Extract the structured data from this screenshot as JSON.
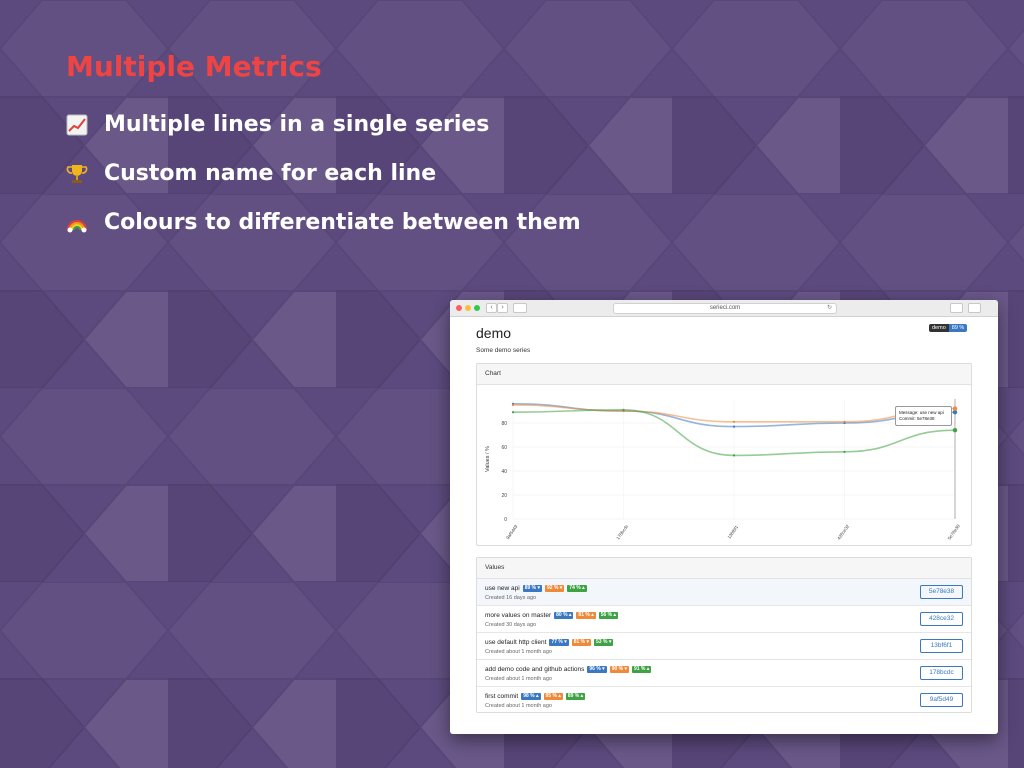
{
  "slide": {
    "title": "Multiple Metrics",
    "bullets": [
      {
        "icon": "chart-increasing-icon",
        "text": "Multiple lines in a single series"
      },
      {
        "icon": "trophy-icon",
        "text": "Custom name for each line"
      },
      {
        "icon": "rainbow-icon",
        "text": "Colours to differentiate between them"
      }
    ]
  },
  "browser": {
    "url": "serieci.com"
  },
  "page": {
    "title": "demo",
    "subtitle": "Some demo series",
    "badge": {
      "label": "demo",
      "value": "89 %"
    }
  },
  "chart_card": {
    "header": "Chart",
    "tooltip": {
      "message": "Message: use new api",
      "commit": "Commit: 5e78e38"
    }
  },
  "chart_data": {
    "type": "line",
    "ylabel": "Values / %",
    "ylim": [
      0,
      100
    ],
    "yticks": [
      0,
      20,
      40,
      60,
      80
    ],
    "categories": [
      "9af5d49",
      "178bcdc",
      "13bf6f1",
      "428ce32",
      "5e78e38"
    ],
    "series": [
      {
        "values": [
          96,
          90,
          77,
          80,
          89
        ],
        "color": "#3a78c2"
      },
      {
        "values": [
          95,
          90,
          81,
          81,
          92
        ],
        "color": "#ee8a3a"
      },
      {
        "values": [
          89,
          91,
          53,
          56,
          74
        ],
        "color": "#3fa244"
      }
    ]
  },
  "values_card": {
    "header": "Values",
    "rows": [
      {
        "title": "use new api",
        "pills": [
          {
            "text": "89 % ▾",
            "color": "blue"
          },
          {
            "text": "92 % ▾",
            "color": "orange"
          },
          {
            "text": "74 % ▴",
            "color": "green"
          }
        ],
        "date": "Created 16 days ago",
        "commit": "5e78e38"
      },
      {
        "title": "more values on master",
        "pills": [
          {
            "text": "80 % ▴",
            "color": "blue"
          },
          {
            "text": "81 % ▴",
            "color": "orange"
          },
          {
            "text": "56 % ▴",
            "color": "green"
          }
        ],
        "date": "Created 30 days ago",
        "commit": "428ce32"
      },
      {
        "title": "use default http client",
        "pills": [
          {
            "text": "77 % ▾",
            "color": "blue"
          },
          {
            "text": "81 % ▾",
            "color": "orange"
          },
          {
            "text": "53 % ▾",
            "color": "green"
          }
        ],
        "date": "Created about 1 month ago",
        "commit": "13bf6f1"
      },
      {
        "title": "add demo code and github actions",
        "pills": [
          {
            "text": "96 % ▾",
            "color": "blue"
          },
          {
            "text": "90 % ▾",
            "color": "orange"
          },
          {
            "text": "91 % ▴",
            "color": "green"
          }
        ],
        "date": "Created about 1 month ago",
        "commit": "178bcdc"
      },
      {
        "title": "first commit",
        "pills": [
          {
            "text": "98 % ▴",
            "color": "blue"
          },
          {
            "text": "95 % ▴",
            "color": "orange"
          },
          {
            "text": "89 % ▴",
            "color": "green"
          }
        ],
        "date": "Created about 1 month ago",
        "commit": "9af5d49"
      }
    ]
  }
}
